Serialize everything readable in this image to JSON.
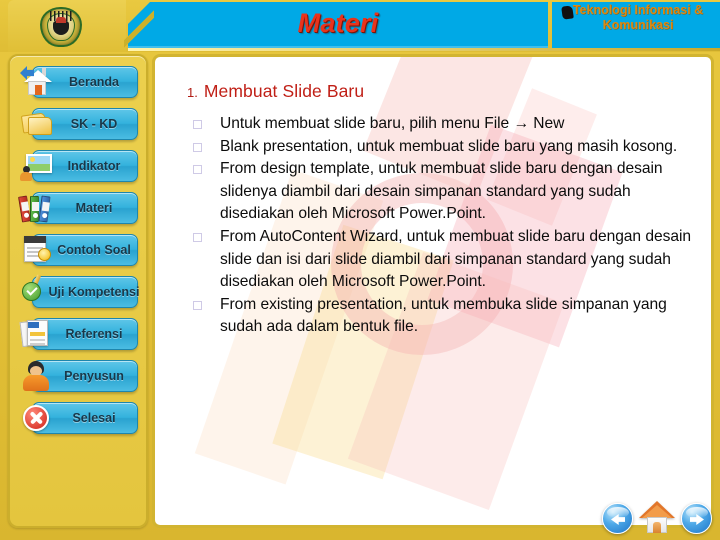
{
  "header": {
    "banner_title": "Materi",
    "subtitle_lines": "Teknologi Informasi & Komunikasi",
    "emblem_name": "university-emblem",
    "banner_color": "#00a9e6",
    "title_color": "#e8331c",
    "subtitle_color": "#d98a17",
    "frame_color": "#e2c13f"
  },
  "sidebar": {
    "items": [
      {
        "label": "Beranda",
        "icon": "home-icon"
      },
      {
        "label": "SK - KD",
        "icon": "folder-icon"
      },
      {
        "label": "Indikator",
        "icon": "picture-person-icon"
      },
      {
        "label": "Materi",
        "icon": "books-icon"
      },
      {
        "label": "Contoh Soal",
        "icon": "document-bulb-icon"
      },
      {
        "label": "Uji Kompetensi",
        "icon": "check-pencil-icon"
      },
      {
        "label": "Referensi",
        "icon": "pages-icon"
      },
      {
        "label": "Penyusun",
        "icon": "person-icon"
      },
      {
        "label": "Selesai",
        "icon": "close-circle-icon"
      }
    ]
  },
  "content": {
    "heading_number": "1.",
    "heading_text": "Membuat Slide Baru",
    "bullets": [
      "Untuk membuat slide baru, pilih menu File → New",
      "Blank presentation, untuk membuat slide baru yang masih kosong.",
      "From design template, untuk membuat slide baru dengan desain slidenya diambil dari desain simpanan standard yang sudah disediakan oleh Microsoft Power.Point.",
      "From AutoContent Wizard, untuk membuat slide baru dengan desain slide dan isi dari slide diambil dari simpanan standard yang sudah disediakan oleh Microsoft Power.Point.",
      "From existing presentation, untuk membuka slide simpanan yang sudah ada dalam bentuk file."
    ]
  },
  "footer_nav": {
    "prev_label": "Previous",
    "home_label": "Home",
    "next_label": "Next"
  }
}
